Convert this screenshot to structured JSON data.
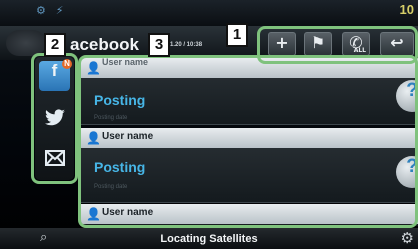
{
  "title": "acebook",
  "timestamp": "1.20 / 10:38",
  "status_right": "10",
  "toolbar": {
    "add_label": "+",
    "flag_label": "⚑",
    "call_label": "ALL",
    "back_label": "↩"
  },
  "callouts": [
    "1",
    "2",
    "3"
  ],
  "sidebar": {
    "facebook_icon": "f",
    "facebook_badge": "N",
    "twitter_icon": "twitter-icon",
    "mail_icon": "mail-icon"
  },
  "posts": [
    {
      "user": "User name",
      "text": "Posting",
      "date": "Posting date"
    },
    {
      "user": "User name",
      "text": "Posting",
      "date": "Posting date"
    },
    {
      "user": "User name"
    }
  ],
  "detail_label": "?",
  "status_text": "Locating Satellites"
}
